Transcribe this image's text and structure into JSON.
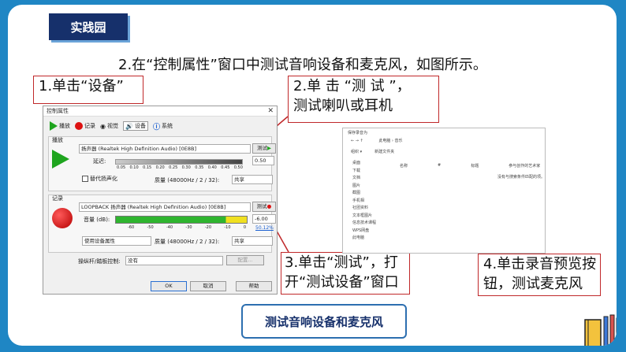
{
  "header": {
    "tag": "实践园",
    "instruction": "2.在“控制属性”窗口中测试音响设备和麦克风，如图所示。"
  },
  "annotations": {
    "a1": "1.单击“设备”",
    "a2_line1": "2.单 击 “测 试 ”，",
    "a2_line2": "测试喇叭或耳机",
    "a3_line1": "3.单击“测试”，打",
    "a3_line2": "开“测试设备”窗口",
    "a4_line1": "4.单击录音预览按",
    "a4_line2": "钮，测试麦克风"
  },
  "dialog": {
    "title": "控制属性",
    "close": "✕",
    "tabs": [
      "播放",
      "记录",
      "视觉",
      "设备",
      "系统"
    ],
    "playback": {
      "label": "播放",
      "device": "扬声器 (Realtek High Definition Audio) [0E8B]",
      "test": "测试",
      "delay_label": "延迟:",
      "delay_value": "0.50",
      "scale": [
        "0.05",
        "0.10",
        "0.15",
        "0.20",
        "0.25",
        "0.30",
        "0.35",
        "0.40",
        "0.45",
        "0.50"
      ],
      "alt_check": "替代扬声化",
      "quality_label": "质量 (48000Hz / 2 / 32):",
      "share": "共享"
    },
    "record": {
      "label": "记录",
      "device": "LOOPBACK 扬声器 (Realtek High Definition Audio) [0E8B]",
      "test": "测试",
      "volume_label": "音量 (dB):",
      "volume_value": "-6.00",
      "pct": "50.12%",
      "scale": [
        "-60",
        "-50",
        "-40",
        "-30",
        "-20",
        "-10",
        "0"
      ],
      "use_device": "使用设备属性",
      "quality_label": "质量 (48000Hz / 2 / 32):",
      "share": "共享"
    },
    "joystick_label": "操纵杆/踏板控制:",
    "joystick_value": "没有",
    "config": "配置...",
    "ok": "OK",
    "cancel": "取消",
    "help": "帮助"
  },
  "explorer": {
    "title": "保存录音为",
    "path": "此电脑 › 音乐",
    "toolbar": [
      "组织 ▾",
      "新建文件夹"
    ],
    "columns": [
      "名称",
      "#",
      "标题",
      "参与创作的艺术家"
    ],
    "empty": "没有与搜索条件匹配的项。",
    "sidebar": [
      "桌面",
      "下载",
      "文档",
      "图片",
      "截图",
      "手机相",
      "社团资料",
      "文本框图片",
      "信息技术课程",
      "WPS网盘",
      "此电脑"
    ]
  },
  "caption": "测试音响设备和麦克风",
  "colors": {
    "frame": "#1f86c4",
    "tag": "#16306b",
    "annot_border": "#c0282a",
    "green": "#1fa51f",
    "red": "#d11111"
  }
}
